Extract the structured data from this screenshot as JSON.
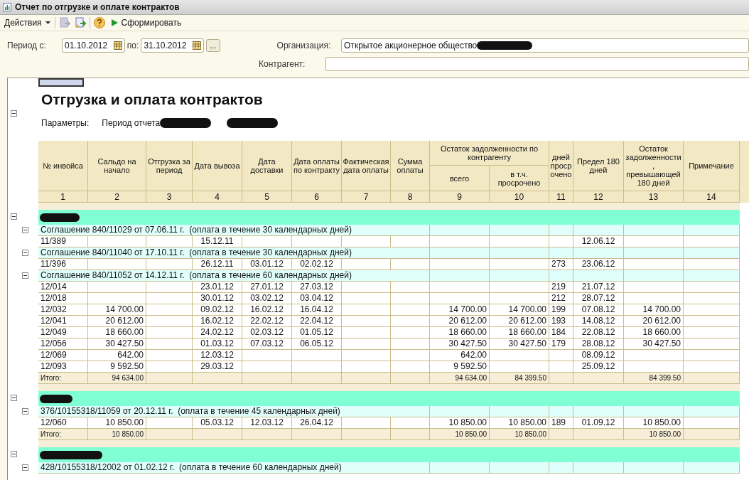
{
  "window": {
    "title": "Отчет по отгрузке и оплате контрактов"
  },
  "toolbar": {
    "actions_menu": "Действия",
    "buttons": [
      {
        "kind": "disabled"
      },
      {
        "kind": "enabled"
      }
    ],
    "generate_button": "Сформировать"
  },
  "form": {
    "period_label": "Период с:",
    "date_from": "01.10.2012",
    "to_label": "по:",
    "date_to": "31.10.2012",
    "more_button": "...",
    "organization_label": "Организация:",
    "organization": "Открытое акционерное общество",
    "counterparty_label": "Контрагент:"
  },
  "report": {
    "title": "Отгрузка и оплата контрактов",
    "params_label": "Параметры:",
    "params_period": "Период отчета",
    "expanded": true,
    "columns": [
      {
        "label": "№ инвойса",
        "number": "1"
      },
      {
        "label": "Сальдо на начало",
        "number": "2"
      },
      {
        "label": "Отгрузка за период",
        "number": "3"
      },
      {
        "label": "Дата вывоза",
        "number": "4"
      },
      {
        "label": "Дата доставки",
        "number": "5"
      },
      {
        "label": "Дата оплаты по контракту",
        "number": "6"
      },
      {
        "label": "Фактическая дата оплаты",
        "number": "7"
      },
      {
        "label": "Сумма оплаты",
        "number": "8"
      },
      {
        "label": "Остаток задолженности по контрагенту",
        "children": [
          {
            "label": "всего",
            "number": "9"
          },
          {
            "label": "в т.ч. просрочено",
            "number": "10"
          }
        ]
      },
      {
        "label": "дней просрочено",
        "number": "11"
      },
      {
        "label": "Предел 180 дней",
        "number": "12"
      },
      {
        "label": "Остаток задолженности, превышающей 180 дней",
        "number": "13"
      },
      {
        "label": "Примечание",
        "number": "14"
      }
    ],
    "groups": [
      {
        "expanded": true,
        "agreements": [
          {
            "expanded": true,
            "title": "Соглашение 840/11029 от 07.06.11 г.  (оплата в течение 30 календарных дней)",
            "rows": [
              [
                "11/389",
                null,
                null,
                "15.12.11",
                null,
                null,
                null,
                null,
                null,
                null,
                null,
                "12.06.12",
                null,
                null
              ]
            ]
          },
          {
            "expanded": true,
            "title": "Соглашение 840/11040 от 17.10.11 г.  (оплата в течение 30 календарных дней)",
            "rows": [
              [
                "11/396",
                null,
                null,
                "26.12.11",
                "03.01.12",
                "02.02.12",
                null,
                null,
                null,
                null,
                "273",
                "23.06.12",
                null,
                null
              ]
            ]
          },
          {
            "expanded": true,
            "title": "Соглашение 840/11052 от 14.12.11 г.  (оплата в течение 60 календарных дней)",
            "rows": [
              [
                "12/014",
                null,
                null,
                "23.01.12",
                "27.01.12",
                "27.03.12",
                null,
                null,
                null,
                null,
                "219",
                "21.07.12",
                null,
                null
              ],
              [
                "12/018",
                null,
                null,
                "30.01.12",
                "03.02.12",
                "03.04.12",
                null,
                null,
                null,
                null,
                "212",
                "28.07.12",
                null,
                null
              ],
              [
                "12/032",
                "14 700.00",
                null,
                "09.02.12",
                "16.02.12",
                "16.04.12",
                null,
                null,
                "14 700.00",
                "14 700.00",
                "199",
                "07.08.12",
                "14 700.00",
                null
              ],
              [
                "12/041",
                "20 612.00",
                null,
                "16.02.12",
                "22.02.12",
                "22.04.12",
                null,
                null,
                "20 612.00",
                "20 612.00",
                "193",
                "14.08.12",
                "20 612.00",
                null
              ],
              [
                "12/049",
                "18 660.00",
                null,
                "24.02.12",
                "02.03.12",
                "01.05.12",
                null,
                null,
                "18 660.00",
                "18 660.00",
                "184",
                "22.08.12",
                "18 660.00",
                null
              ],
              [
                "12/056",
                "30 427.50",
                null,
                "01.03.12",
                "07.03.12",
                "06.05.12",
                null,
                null,
                "30 427.50",
                "30 427.50",
                "179",
                "28.08.12",
                "30 427.50",
                null
              ],
              [
                "12/069",
                "642.00",
                null,
                "12.03.12",
                null,
                null,
                null,
                null,
                "642.00",
                null,
                null,
                "08.09.12",
                null,
                null
              ],
              [
                "12/093",
                "9 592.50",
                null,
                "29.03.12",
                null,
                null,
                null,
                null,
                "9 592.50",
                null,
                null,
                "25.09.12",
                null,
                null
              ]
            ]
          }
        ],
        "total": {
          "label": "Итого:",
          "opening_balance": "94 634.00",
          "debt_total": "94 634.00",
          "debt_overdue": "84 399.50",
          "debt_over_180": "84 399.50"
        }
      },
      {
        "expanded": true,
        "agreements": [
          {
            "expanded": true,
            "title": "376/10155318/11059 от 20.12.11 г.  (оплата в течение 45 календарных дней)",
            "rows": [
              [
                "12/060",
                "10 850.00",
                null,
                "05.03.12",
                "12.03.12",
                "26.04.12",
                null,
                null,
                "10 850.00",
                "10 850.00",
                "189",
                "01.09.12",
                "10 850.00",
                null
              ]
            ]
          }
        ],
        "total": {
          "label": "Итого:",
          "opening_balance": "10 850.00",
          "debt_total": "10 850.00",
          "debt_overdue": "10 850.00",
          "debt_over_180": "10 850.00"
        }
      },
      {
        "expanded": true,
        "agreements": [
          {
            "expanded": true,
            "title": "428/10155318/12002 от 01.02.12 г.  (оплата в течение 60 календарных дней)"
          }
        ]
      }
    ]
  }
}
